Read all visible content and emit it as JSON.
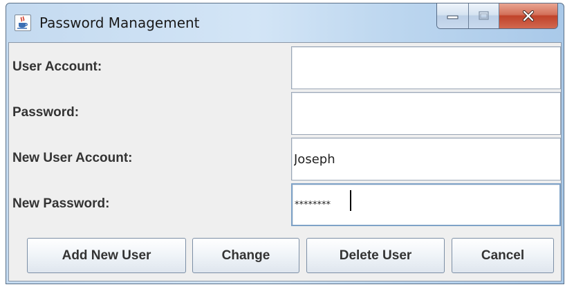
{
  "window": {
    "title": "Password Management",
    "icon": "java-cup-icon",
    "controls": [
      "minimize-icon",
      "maximize-icon",
      "close-icon"
    ]
  },
  "form": {
    "user_account_label": "User Account:",
    "user_account_value": "",
    "password_label": "Password:",
    "password_value": "",
    "new_user_account_label": "New User Account:",
    "new_user_account_value": "Joseph",
    "new_password_label": "New Password:",
    "new_password_value": "********"
  },
  "buttons": {
    "add_new_user": "Add New User",
    "change": "Change",
    "delete_user": "Delete User",
    "cancel": "Cancel"
  },
  "colors": {
    "close_button": "#c7452c",
    "client_background": "#efefef",
    "focus_border": "#7ea2c7"
  }
}
